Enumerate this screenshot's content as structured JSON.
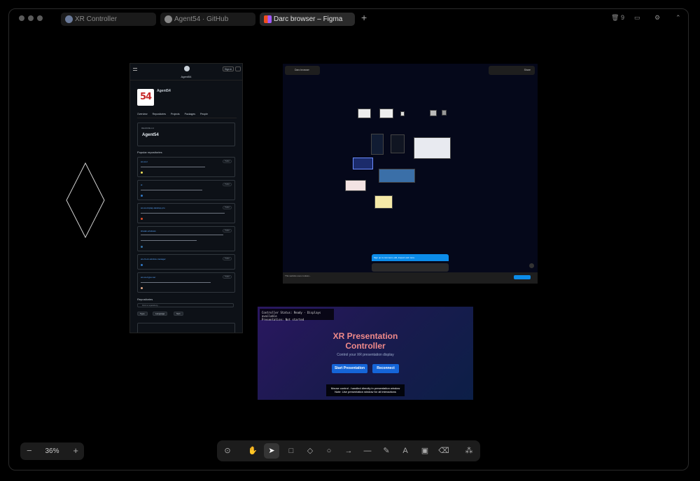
{
  "window": {
    "tabs": [
      {
        "label": "XR Controller",
        "icon": "globe-icon"
      },
      {
        "label": "Agent54 · GitHub",
        "icon": "github-icon"
      },
      {
        "label": "Darc browser – Figma",
        "icon": "figma-icon"
      }
    ],
    "new_tab": "+",
    "trash_count": "9"
  },
  "github": {
    "user_name": "Agent54",
    "sign_in": "Sign in",
    "avatar_text": "54",
    "tabs": [
      "Overview",
      "Repositories",
      "Projects",
      "Packages",
      "People"
    ],
    "readme_small": "README.md",
    "readme_title": "Agent54",
    "popular_title": "Popular repositories",
    "repos": [
      {
        "name": "ws-tool",
        "lang_color": "#f1e05a"
      },
      {
        "name": "ai",
        "lang_color": "#3178c6"
      },
      {
        "name": "ws-tool-tiptap-desktop-pro",
        "lang_color": "#e34c26"
      },
      {
        "name": "shader-windows",
        "lang_color": "#3572A5"
      },
      {
        "name": "ws-rtl-ws-window-manager",
        "lang_color": "#3178c6"
      },
      {
        "name": "ws-ws-hyper-ter",
        "lang_color": "#dea584"
      }
    ],
    "public_label": "Public",
    "repositories_title": "Repositories",
    "search_placeholder": "Find a repository...",
    "filters": [
      "Type",
      "Language",
      "Sort"
    ]
  },
  "figma": {
    "file_name": "Darc browser",
    "share": "Share",
    "banner": "Sign up to comment, edit, inspect and more.",
    "cookie_text": "This website uses cookies..."
  },
  "xr": {
    "status_line1": "Controller Status: Ready - Displays available",
    "status_line2": "Presentation: Not started",
    "title_line1": "XR Presentation",
    "title_line2": "Controller",
    "subtitle": "Control your XR presentation display",
    "start_button": "Start Presentation",
    "reconnect_button": "Reconnect",
    "note_line1": "Mouse control - handled directly in presentation window",
    "note_line2": "Note: Use presentation window for all interactions"
  },
  "zoom": {
    "minus": "−",
    "value": "36%",
    "plus": "+"
  },
  "tools": [
    {
      "name": "lock-tool",
      "glyph": "⊙"
    },
    {
      "name": "hand-tool",
      "glyph": "✋"
    },
    {
      "name": "select-tool",
      "glyph": "➤",
      "selected": true
    },
    {
      "name": "rectangle-tool",
      "glyph": "□"
    },
    {
      "name": "diamond-tool",
      "glyph": "◇"
    },
    {
      "name": "ellipse-tool",
      "glyph": "○"
    },
    {
      "name": "arrow-tool",
      "glyph": "→"
    },
    {
      "name": "line-tool",
      "glyph": "—"
    },
    {
      "name": "pencil-tool",
      "glyph": "✎"
    },
    {
      "name": "text-tool",
      "glyph": "A"
    },
    {
      "name": "image-tool",
      "glyph": "▣"
    },
    {
      "name": "eraser-tool",
      "glyph": "⌫"
    },
    {
      "name": "shapes-tool",
      "glyph": "⁂"
    }
  ]
}
